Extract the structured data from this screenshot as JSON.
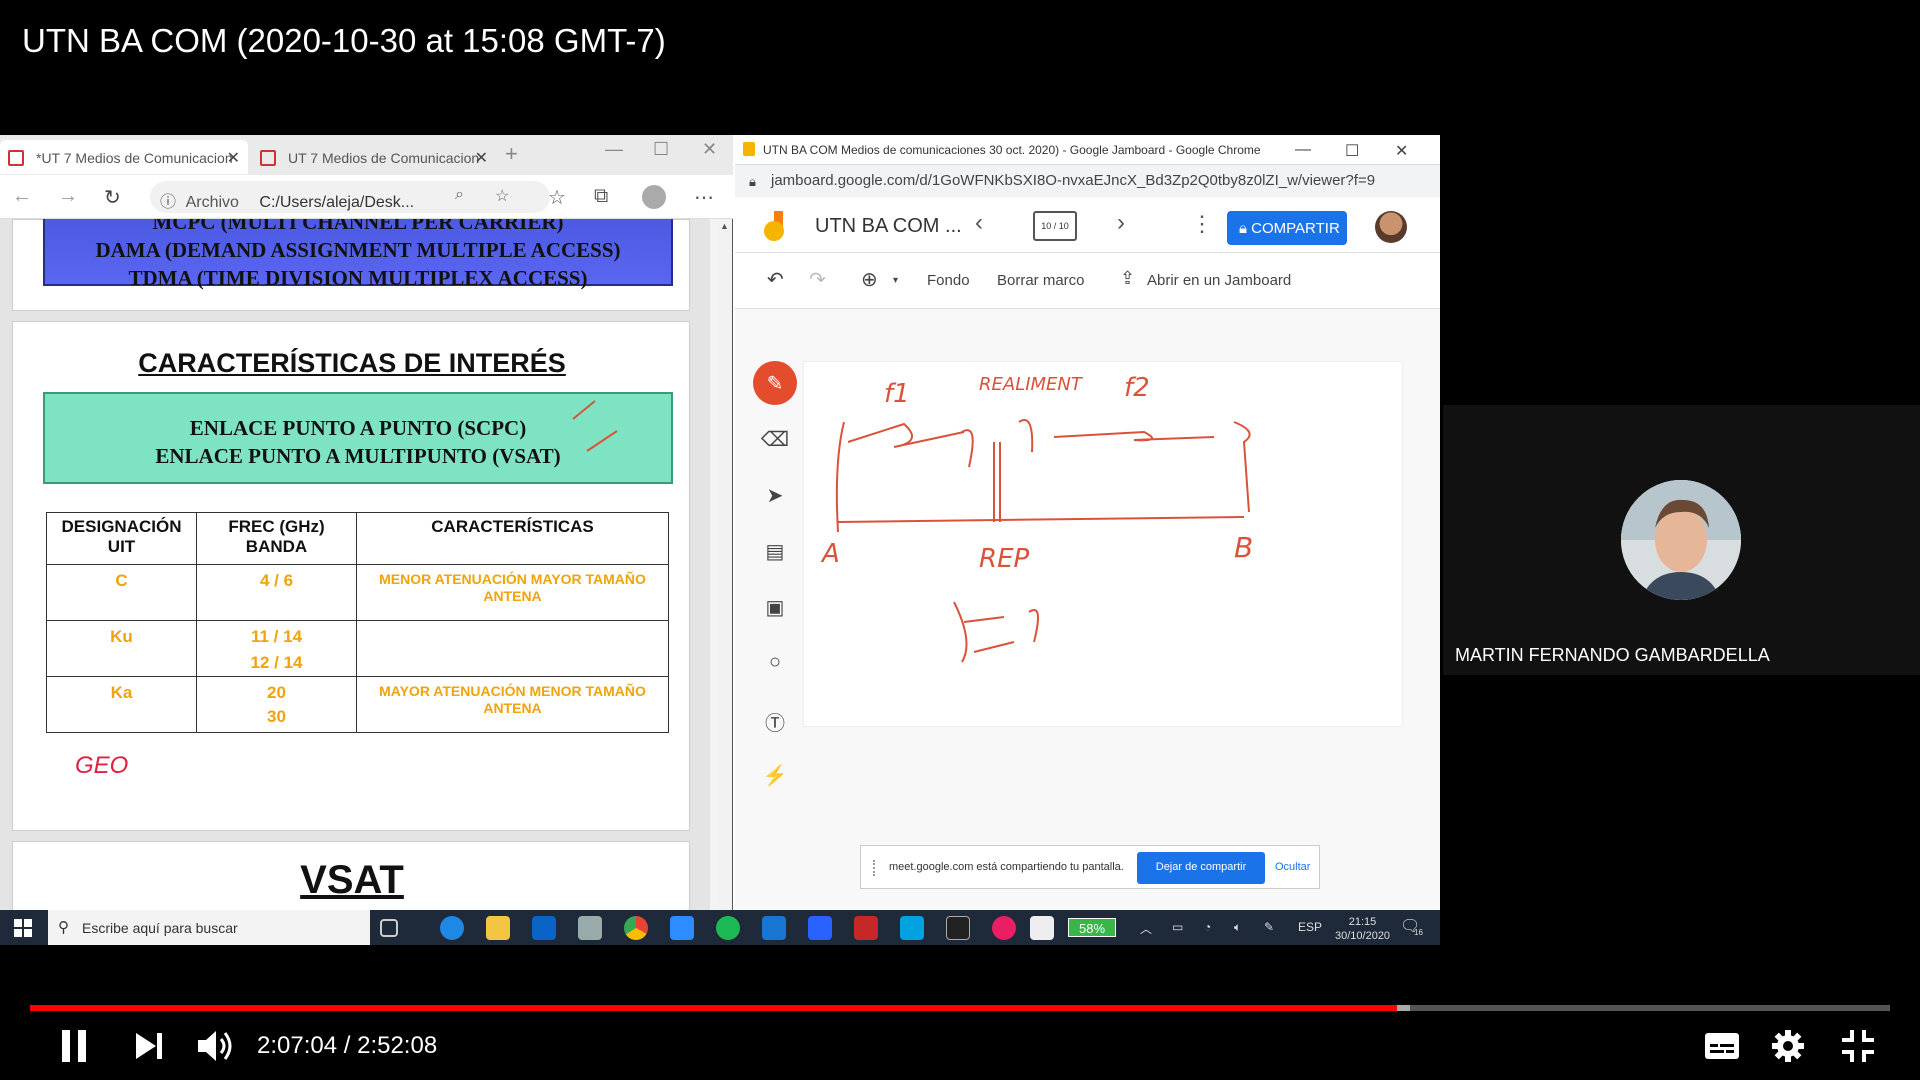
{
  "video": {
    "title": "UTN BA COM (2020-10-30 at 15:08 GMT-7)",
    "current_time": "2:07:04",
    "duration": "2:52:08",
    "time_separator": " / ",
    "progress_fraction": 0.735,
    "buffered_fraction": 0.742
  },
  "edge": {
    "tab1": "*UT 7 Medios de Comunicacion",
    "tab2": "UT 7 Medios de Comunicacion",
    "address_label": "Archivo",
    "address_path": "C:/Users/aleja/Desk..."
  },
  "slide1": {
    "lines": [
      "MCPC (MULTI CHANNEL PER CARRIER)",
      "DAMA (DEMAND ASSIGNMENT MULTIPLE ACCESS)",
      "TDMA (TIME DIVISION MULTIPLEX ACCESS)"
    ]
  },
  "slide2": {
    "heading": "CARACTERÍSTICAS DE INTERÉS",
    "green_line1": "ENLACE PUNTO A PUNTO (SCPC)",
    "green_line2": "ENLACE PUNTO A MULTIPUNTO (VSAT)",
    "table": {
      "headers": [
        "DESIGNACIÓN UIT",
        "FREC (GHz) BANDA",
        "CARACTERÍSTICAS"
      ],
      "rows": [
        {
          "designacion": "C",
          "frec": "4 / 6",
          "frec2": "",
          "caract": "MENOR ATENUACIÓN MAYOR TAMAÑO ANTENA"
        },
        {
          "designacion": "Ku",
          "frec": "11 / 14",
          "frec2": "12 / 14",
          "caract": ""
        },
        {
          "designacion": "Ka",
          "frec": "20",
          "frec2": "30",
          "caract": "MAYOR ATENUACIÓN MENOR TAMAÑO ANTENA"
        }
      ]
    },
    "handwritten": "GEO"
  },
  "slide3": {
    "heading": "VSAT"
  },
  "chrome": {
    "window_title": "UTN BA COM Medios de comunicaciones 30 oct. 2020) - Google Jamboard - Google Chrome",
    "url": "jamboard.google.com/d/1GoWFNKbSXI8O-nvxaEJncX_Bd3Zp2Q0tby8z0lZI_w/viewer?f=9"
  },
  "jamboard": {
    "title": "UTN BA COM ...",
    "frame_counter": "10 / 10",
    "share_label": "COMPARTIR",
    "tool_fondo": "Fondo",
    "tool_borrar": "Borrar marco",
    "tool_abrir": "Abrir en un Jamboard",
    "drawing_labels": {
      "f1": "f1",
      "f2": "f2",
      "realimento": "REALIMENT",
      "a": "A",
      "b": "B",
      "rep": "REP"
    },
    "ink_color": "#d9533a"
  },
  "screenshare": {
    "message": "meet.google.com está compartiendo tu pantalla.",
    "stop": "Dejar de compartir",
    "hide": "Ocultar"
  },
  "taskbar": {
    "search_placeholder": "Escribe aquí para buscar",
    "battery": "58%",
    "language": "ESP",
    "time": "21:15",
    "date": "30/10/2020",
    "notification_count": "16"
  },
  "participant": {
    "name": "MARTIN FERNANDO GAMBARDELLA"
  },
  "colors": {
    "accent_red": "#ff0000",
    "meet_blue": "#1a73e8",
    "slide_orange": "#f2a20a"
  }
}
